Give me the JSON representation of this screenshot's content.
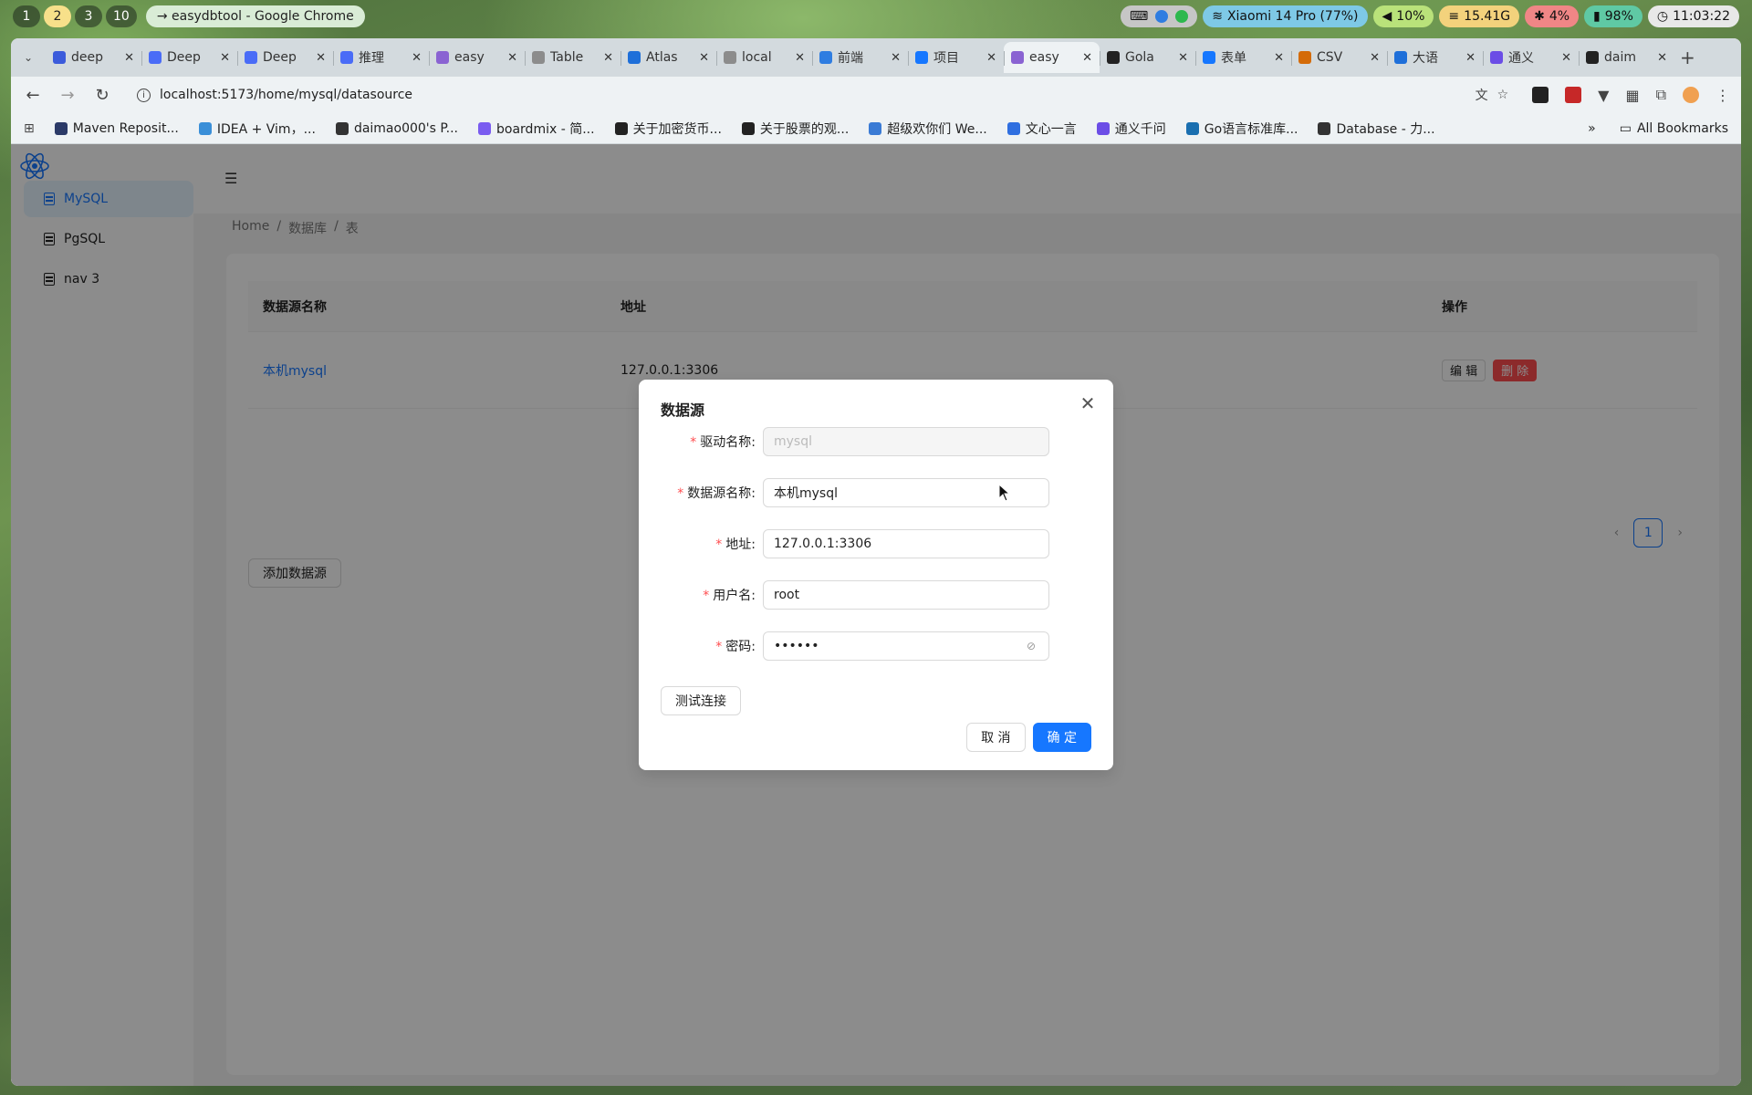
{
  "topbar": {
    "workspaces": [
      "1",
      "2",
      "3",
      "10"
    ],
    "active_workspace": "2",
    "window_title": "→ easydbtool - Google Chrome",
    "wifi": "Xiaomi 14 Pro (77%)",
    "volume": "10%",
    "memory": "15.41G",
    "cpu": "4%",
    "battery": "98%",
    "time": "11:03:22"
  },
  "tabs": [
    {
      "label": "deep",
      "color": "#3b5bdb",
      "icon": "paw-icon"
    },
    {
      "label": "Deep",
      "color": "#4a6cf7",
      "icon": "whale-icon"
    },
    {
      "label": "Deep",
      "color": "#4a6cf7",
      "icon": "whale-icon"
    },
    {
      "label": "推理",
      "color": "#4a6cf7",
      "icon": "whale-icon"
    },
    {
      "label": "easy",
      "color": "#8a63d2",
      "icon": "vite-icon"
    },
    {
      "label": "Table",
      "color": "#8c8c8c",
      "icon": "gear-icon"
    },
    {
      "label": "Atlas",
      "color": "#1e6fd9",
      "icon": "db-icon"
    },
    {
      "label": "local",
      "color": "#8c8c8c",
      "icon": "page-icon"
    },
    {
      "label": "前端",
      "color": "#2f7de1",
      "icon": "send-icon"
    },
    {
      "label": "项目",
      "color": "#1677ff",
      "icon": "h-icon"
    },
    {
      "label": "easy",
      "color": "#8a63d2",
      "icon": "vite-icon",
      "active": true
    },
    {
      "label": "Gola",
      "color": "#222222",
      "icon": "k-icon"
    },
    {
      "label": "表单",
      "color": "#1677ff",
      "icon": "diamond-icon"
    },
    {
      "label": "CSV",
      "color": "#d46b08",
      "icon": "face-icon"
    },
    {
      "label": "大语",
      "color": "#1e6fd9",
      "icon": "db-icon"
    },
    {
      "label": "通义",
      "color": "#6b4de6",
      "icon": "tongyi-icon"
    },
    {
      "label": "daim",
      "color": "#222222",
      "icon": "github-icon"
    }
  ],
  "address": {
    "url": "localhost:5173/home/mysql/datasource"
  },
  "bookmarks": [
    {
      "label": "Maven Reposit...",
      "color": "#2b3a67"
    },
    {
      "label": "IDEA + Vim，...",
      "color": "#3a8fd8"
    },
    {
      "label": "daimao000's P...",
      "color": "#333333"
    },
    {
      "label": "boardmix - 简...",
      "color": "#7a5cf0"
    },
    {
      "label": "关于加密货币...",
      "color": "#222222"
    },
    {
      "label": "关于股票的观...",
      "color": "#222222"
    },
    {
      "label": "超级欢你们 We...",
      "color": "#3a7bd5"
    },
    {
      "label": "文心一言",
      "color": "#2f6fe0"
    },
    {
      "label": "通义千问",
      "color": "#6b4de6"
    },
    {
      "label": "Go语言标准库...",
      "color": "#1a6fb0"
    },
    {
      "label": "Database - 力...",
      "color": "#333333"
    }
  ],
  "all_bookmarks": "All Bookmarks",
  "sidebar": {
    "items": [
      {
        "label": "MySQL",
        "selected": true
      },
      {
        "label": "PgSQL"
      },
      {
        "label": "nav 3"
      }
    ]
  },
  "breadcrumb": [
    "Home",
    "/",
    "数据库",
    "/",
    "表"
  ],
  "table": {
    "columns": [
      "数据源名称",
      "地址",
      "",
      "操作"
    ],
    "rows": [
      {
        "name": "本机mysql",
        "addr": "127.0.0.1:3306",
        "edit": "编 辑",
        "delete": "删 除"
      }
    ]
  },
  "pagination": {
    "current": "1"
  },
  "add_button": "添加数据源",
  "modal": {
    "title": "数据源",
    "fields": [
      {
        "label": "驱动名称",
        "value": "",
        "placeholder": "mysql",
        "disabled": true
      },
      {
        "label": "数据源名称",
        "value": "本机mysql"
      },
      {
        "label": "地址",
        "value": "127.0.0.1:3306"
      },
      {
        "label": "用户名",
        "value": "root"
      },
      {
        "label": "密码",
        "value": "••••••"
      }
    ],
    "test_button": "测试连接",
    "cancel": "取 消",
    "ok": "确 定"
  },
  "colors": {
    "primary": "#1677ff",
    "danger": "#ff4d4f"
  }
}
